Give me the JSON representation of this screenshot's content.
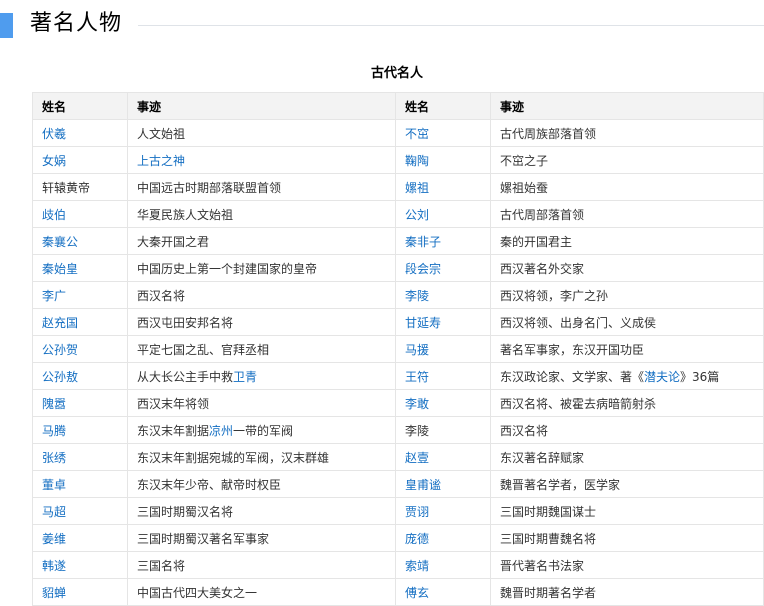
{
  "section_title": "著名人物",
  "table_caption": "古代名人",
  "headers": [
    "姓名",
    "事迹",
    "姓名",
    "事迹"
  ],
  "rows": [
    {
      "name1": "伏羲",
      "name1_link": true,
      "deed1": [
        [
          "人文始祖",
          false
        ]
      ],
      "name2": "不窋",
      "name2_link": true,
      "deed2": [
        [
          "古代周族部落首领",
          false
        ]
      ]
    },
    {
      "name1": "女娲",
      "name1_link": true,
      "deed1": [
        [
          "上古之神",
          true
        ]
      ],
      "name2": "鞠陶",
      "name2_link": true,
      "deed2": [
        [
          "不窋之子",
          false
        ]
      ]
    },
    {
      "name1": "轩辕黄帝",
      "name1_link": false,
      "deed1": [
        [
          "中国远古时期部落联盟首领",
          false
        ]
      ],
      "name2": "嫘祖",
      "name2_link": true,
      "deed2": [
        [
          "嫘祖始蚕",
          false
        ]
      ]
    },
    {
      "name1": "歧伯",
      "name1_link": true,
      "deed1": [
        [
          "华夏民族人文始祖",
          false
        ]
      ],
      "name2": "公刘",
      "name2_link": true,
      "deed2": [
        [
          "古代周部落首领",
          false
        ]
      ]
    },
    {
      "name1": "秦襄公",
      "name1_link": true,
      "deed1": [
        [
          "大秦开国之君",
          false
        ]
      ],
      "name2": "秦非子",
      "name2_link": true,
      "deed2": [
        [
          "秦的开国君主",
          false
        ]
      ]
    },
    {
      "name1": "秦始皇",
      "name1_link": true,
      "deed1": [
        [
          "中国历史上第一个封建国家的皇帝",
          false
        ]
      ],
      "name2": "段会宗",
      "name2_link": true,
      "deed2": [
        [
          "西汉著名外交家",
          false
        ]
      ]
    },
    {
      "name1": "李广",
      "name1_link": true,
      "deed1": [
        [
          "西汉名将",
          false
        ]
      ],
      "name2": "李陵",
      "name2_link": true,
      "deed2": [
        [
          "西汉将领，李广之孙",
          false
        ]
      ]
    },
    {
      "name1": "赵充国",
      "name1_link": true,
      "deed1": [
        [
          "西汉屯田安邦名将",
          false
        ]
      ],
      "name2": "甘延寿",
      "name2_link": true,
      "deed2": [
        [
          "西汉将领、出身名门、义成侯",
          false
        ]
      ]
    },
    {
      "name1": "公孙贺",
      "name1_link": true,
      "deed1": [
        [
          "平定七国之乱、官拜丞相",
          false
        ]
      ],
      "name2": "马援",
      "name2_link": true,
      "deed2": [
        [
          "著名军事家，东汉开国功臣",
          false
        ]
      ]
    },
    {
      "name1": "公孙敖",
      "name1_link": true,
      "deed1": [
        [
          "从大长公主手中救",
          false
        ],
        [
          "卫青",
          true
        ]
      ],
      "name2": "王符",
      "name2_link": true,
      "deed2": [
        [
          "东汉政论家、文学家、著《",
          false
        ],
        [
          "潜夫论",
          true
        ],
        [
          "》36篇",
          false
        ]
      ]
    },
    {
      "name1": "隗嚣",
      "name1_link": true,
      "deed1": [
        [
          "西汉末年将领",
          false
        ]
      ],
      "name2": "李敢",
      "name2_link": true,
      "deed2": [
        [
          "西汉名将、被霍去病暗箭射杀",
          false
        ]
      ]
    },
    {
      "name1": "马腾",
      "name1_link": true,
      "deed1": [
        [
          "东汉末年割据",
          false
        ],
        [
          "凉州",
          true
        ],
        [
          "一带的军阀",
          false
        ]
      ],
      "name2": "李陵",
      "name2_link": false,
      "deed2": [
        [
          "西汉名将",
          false
        ]
      ]
    },
    {
      "name1": "张绣",
      "name1_link": true,
      "deed1": [
        [
          "东汉末年割据宛城的军阀，汉末群雄",
          false
        ]
      ],
      "name2": "赵壹",
      "name2_link": true,
      "deed2": [
        [
          "东汉著名辞赋家",
          false
        ]
      ]
    },
    {
      "name1": "董卓",
      "name1_link": true,
      "deed1": [
        [
          "东汉末年少帝、献帝时权臣",
          false
        ]
      ],
      "name2": "皇甫谧",
      "name2_link": true,
      "deed2": [
        [
          "魏晋著名学者，医学家",
          false
        ]
      ]
    },
    {
      "name1": "马超",
      "name1_link": true,
      "deed1": [
        [
          "三国时期蜀汉名将",
          false
        ]
      ],
      "name2": "贾诩",
      "name2_link": true,
      "deed2": [
        [
          "三国时期魏国谋士",
          false
        ]
      ]
    },
    {
      "name1": "姜维",
      "name1_link": true,
      "deed1": [
        [
          "三国时期蜀汉著名军事家",
          false
        ]
      ],
      "name2": "庞德",
      "name2_link": true,
      "deed2": [
        [
          "三国时期曹魏名将",
          false
        ]
      ]
    },
    {
      "name1": "韩遂",
      "name1_link": true,
      "deed1": [
        [
          "三国名将",
          false
        ]
      ],
      "name2": "索靖",
      "name2_link": true,
      "deed2": [
        [
          "晋代著名书法家",
          false
        ]
      ]
    },
    {
      "name1": "貂蝉",
      "name1_link": true,
      "deed1": [
        [
          "中国古代四大美女之一",
          false
        ]
      ],
      "name2": "傅玄",
      "name2_link": true,
      "deed2": [
        [
          "魏晋时期著名学者",
          false
        ]
      ]
    }
  ]
}
